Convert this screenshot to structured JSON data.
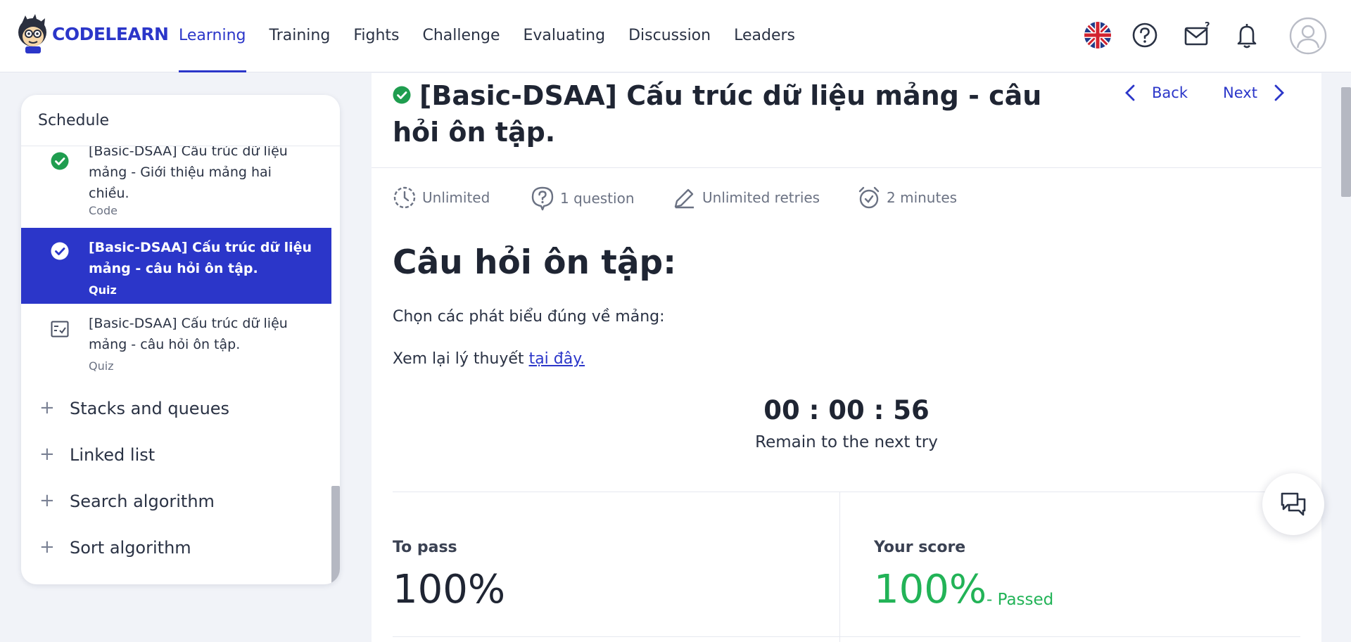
{
  "brand": {
    "name": "CODELEARN"
  },
  "nav": {
    "items": [
      "Learning",
      "Training",
      "Fights",
      "Challenge",
      "Evaluating",
      "Discussion",
      "Leaders"
    ],
    "active_index": 0
  },
  "header_icons": [
    "uk-flag-icon",
    "help-icon",
    "mail-icon",
    "bell-icon",
    "user-avatar-icon"
  ],
  "sidebar": {
    "title": "Schedule",
    "lessons": [
      {
        "title": "[Basic-DSAA] Cấu trúc dữ liệu mảng - Giới thiệu mảng hai chiều.",
        "type": "Code",
        "status": "completed"
      },
      {
        "title": "[Basic-DSAA] Cấu trúc dữ liệu mảng - câu hỏi ôn tập.",
        "type": "Quiz",
        "status": "completed-active"
      },
      {
        "title": "[Basic-DSAA] Cấu trúc dữ liệu mảng - câu hỏi ôn tập.",
        "type": "Quiz",
        "status": "quiz"
      }
    ],
    "sections": [
      "Stacks and queues",
      "Linked list",
      "Search algorithm",
      "Sort algorithm"
    ]
  },
  "main": {
    "title": "[Basic-DSAA] Cấu trúc dữ liệu mảng - câu hỏi ôn tập.",
    "back_label": "Back",
    "next_label": "Next",
    "meta": {
      "time": "Unlimited",
      "questions": "1 question",
      "retries": "Unlimited retries",
      "duration": "2 minutes"
    },
    "question_heading": "Câu hỏi ôn tập:",
    "question_text": "Chọn các phát biểu đúng về mảng:",
    "review_prefix": "Xem lại lý thuyết ",
    "review_link": "tại đây.",
    "timer": "00 : 00 : 56",
    "timer_label": "Remain to the next try",
    "to_pass_label": "To pass",
    "to_pass_value": "100%",
    "score_label": "Your score",
    "score_value": "100%",
    "score_status": "- Passed"
  },
  "colors": {
    "accent": "#2b36c9",
    "success": "#22b357",
    "completed_icon": "#1f9d4f"
  }
}
